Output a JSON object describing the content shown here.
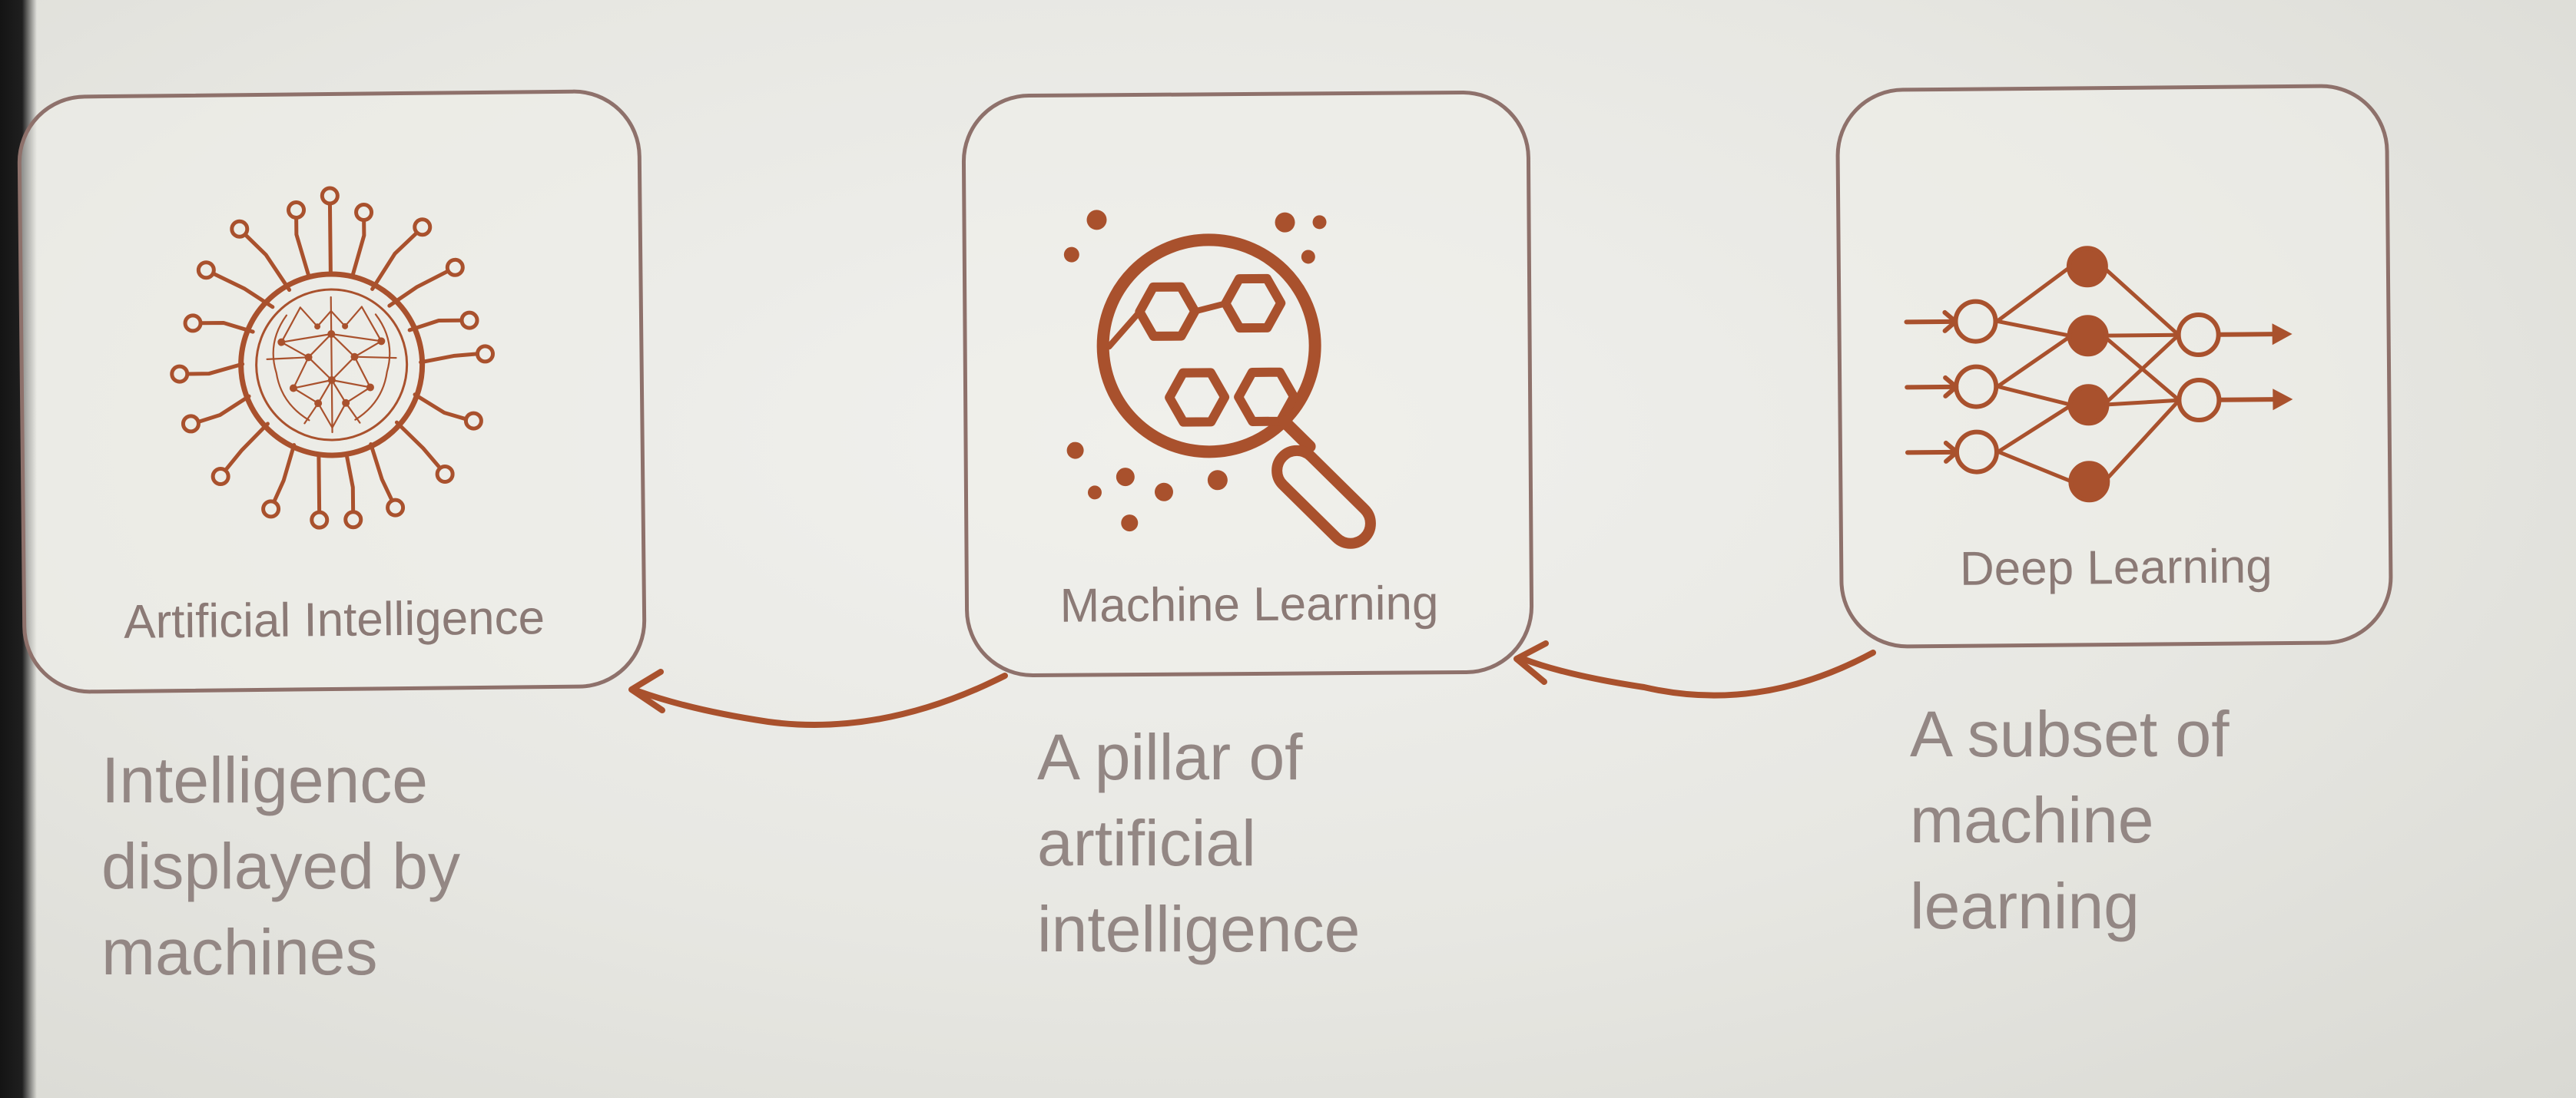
{
  "colors": {
    "accent": "#a9512d",
    "border": "#8e716b",
    "label_text": "#8b7a76",
    "caption_text": "#938784",
    "background": "#e9e9e5"
  },
  "cards": [
    {
      "label": "Artificial Intelligence",
      "icon": "brain-circuit-icon",
      "caption": "Intelligence\ndisplayed by\nmachines"
    },
    {
      "label": "Machine Learning",
      "icon": "magnifier-hexagons-icon",
      "caption": "A pillar of\nartificial\nintelligence"
    },
    {
      "label": "Deep Learning",
      "icon": "neural-network-icon",
      "caption": "A subset of\nmachine\nlearning"
    }
  ],
  "connections": [
    {
      "from": "Machine Learning",
      "to": "Artificial Intelligence"
    },
    {
      "from": "Deep Learning",
      "to": "Machine Learning"
    }
  ]
}
